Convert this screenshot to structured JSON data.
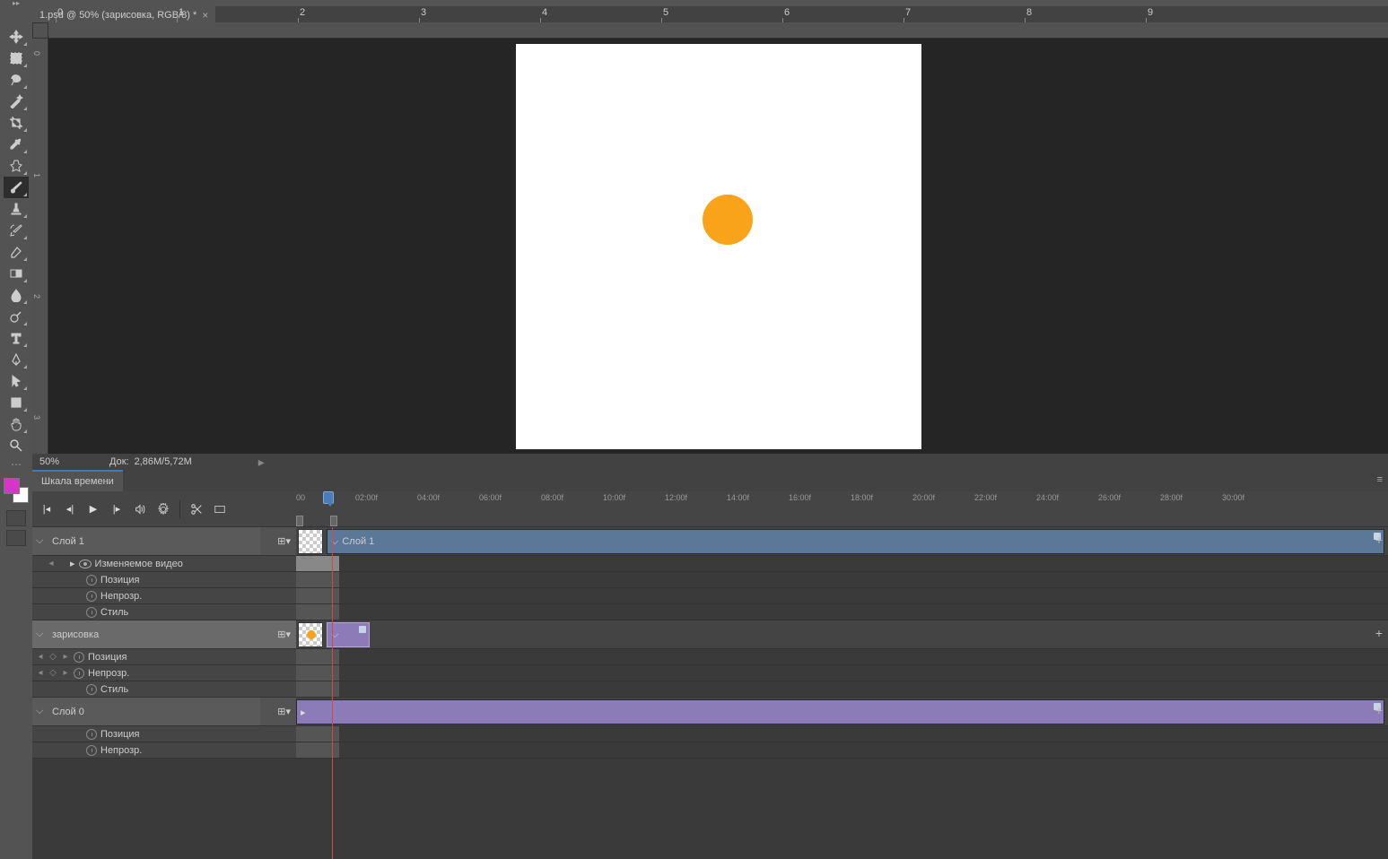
{
  "document": {
    "tab_title": "1.psd @ 50% (зарисовка, RGB/8) *"
  },
  "status": {
    "zoom": "50%",
    "doc_label": "Док:",
    "doc_size": "2,86M/5,72M"
  },
  "ruler_h": [
    "0",
    "1",
    "2",
    "3",
    "4",
    "5",
    "6",
    "7",
    "8",
    "9"
  ],
  "ruler_v": [
    "0",
    "1",
    "2",
    "3"
  ],
  "timeline": {
    "panel_title": "Шкала времени",
    "ticks": [
      "00",
      "02:00f",
      "04:00f",
      "06:00f",
      "08:00f",
      "10:00f",
      "12:00f",
      "14:00f",
      "16:00f",
      "18:00f",
      "20:00f",
      "22:00f",
      "24:00f",
      "26:00f",
      "28:00f",
      "30:00f"
    ],
    "tracks": [
      {
        "name": "Слой 1",
        "clip_label": "Слой 1",
        "clip_color": "blue",
        "props": [
          {
            "label": "Изменяемое видео",
            "has_eye": true,
            "has_nav": true
          },
          {
            "label": "Позиция",
            "has_stopwatch": true
          },
          {
            "label": "Непрозр.",
            "has_stopwatch": true
          },
          {
            "label": "Стиль",
            "has_stopwatch": true
          }
        ]
      },
      {
        "name": "зарисовка",
        "clip_color": "purple",
        "props": [
          {
            "label": "Позиция",
            "has_stopwatch": true,
            "has_keynav": true
          },
          {
            "label": "Непрозр.",
            "has_stopwatch": true,
            "has_keynav": true
          },
          {
            "label": "Стиль",
            "has_stopwatch": true
          }
        ]
      },
      {
        "name": "Слой 0",
        "clip_color": "purple-big",
        "props": [
          {
            "label": "Позиция",
            "has_stopwatch": true
          },
          {
            "label": "Непрозр.",
            "has_stopwatch": true
          }
        ]
      }
    ]
  },
  "tools": [
    "move",
    "marquee",
    "lasso",
    "wand",
    "crop",
    "eyedropper",
    "healing",
    "brush",
    "stamp",
    "history-brush",
    "eraser",
    "gradient",
    "blur",
    "dodge",
    "pen",
    "type",
    "path-select",
    "direct-select",
    "shape",
    "hand",
    "zoom"
  ],
  "colors": {
    "foreground": "#d834c8",
    "background": "#ffffff",
    "accent_blue": "#5c7899",
    "accent_purple": "#8b7cb8",
    "orange": "#f9a31a"
  }
}
